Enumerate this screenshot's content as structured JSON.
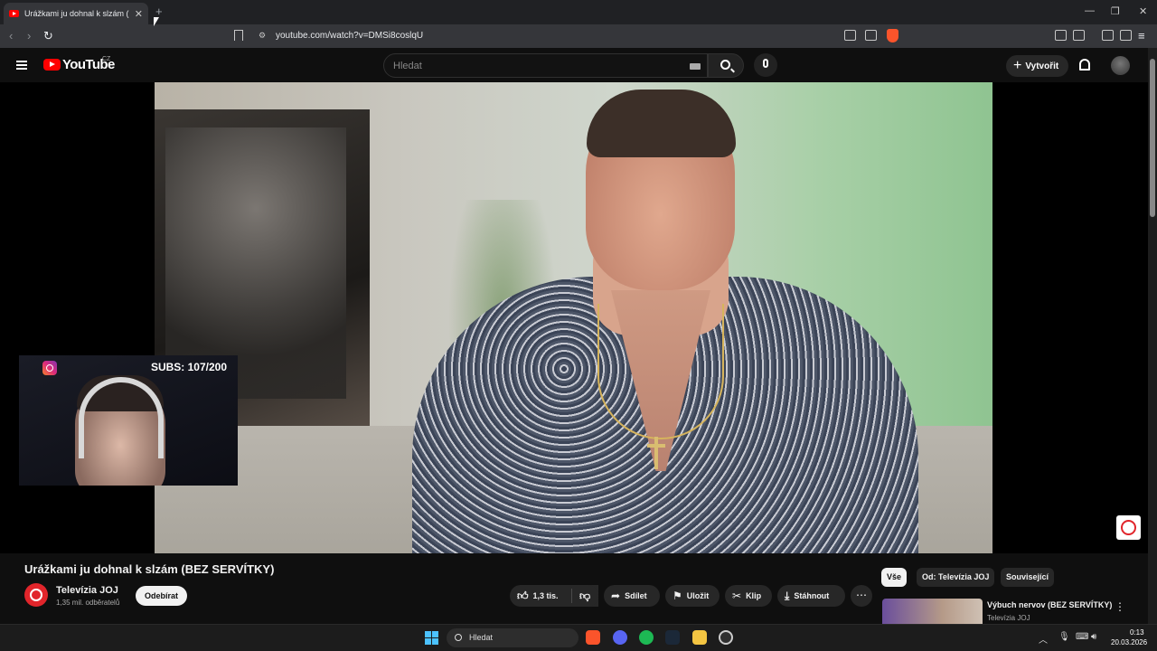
{
  "browser": {
    "tab_title": "Urážkami ju dohnal k slzám (BEZ",
    "tab_close": "✕",
    "new_tab": "+",
    "url": "youtube.com/watch?v=DMSi8coslqU",
    "window_controls": {
      "minimize": "—",
      "maximize": "❐",
      "close": "✕"
    }
  },
  "youtube": {
    "wordmark": "YouTube",
    "country": "CZ",
    "search_placeholder": "Hledat",
    "create_label": "Vytvořit"
  },
  "overlay": {
    "subs_text": "SUBS: 107/200"
  },
  "video": {
    "title": "Urážkami ju dohnal k slzám (BEZ SERVÍTKY)",
    "channel_name": "Televízia JOJ",
    "channel_subs": "1,35 mil. odběratelů",
    "subscribe_label": "Odebírat",
    "like_count": "1,3 tis.",
    "share_label": "Sdílet",
    "save_label": "Uložit",
    "clip_label": "Klip",
    "download_label": "Stáhnout",
    "more_label": "⋯"
  },
  "sidebar": {
    "chips": [
      "Vše",
      "Od: Televízia JOJ",
      "Související"
    ],
    "active_chip": "Vše",
    "recommendation": {
      "title": "Výbuch nervov (BEZ SERVÍTKY)",
      "channel": "Televízia JOJ"
    }
  },
  "taskbar": {
    "search_label": "Hledat",
    "time": "0:13",
    "date": "20.03.2026"
  },
  "colors": {
    "yt_red": "#ff0000",
    "joj_red": "#e1252b",
    "background": "#0f0f0f",
    "pill": "#272727"
  }
}
